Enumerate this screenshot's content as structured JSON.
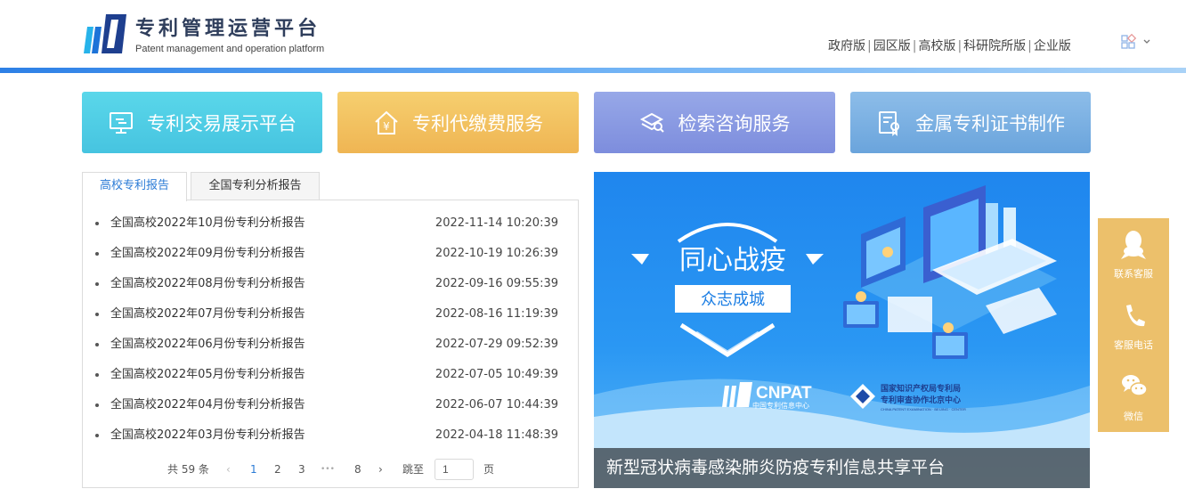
{
  "header": {
    "title": "专利管理运营平台",
    "subtitle": "Patent management and operation platform",
    "versions": [
      "政府版",
      "园区版",
      "高校版",
      "科研院所版",
      "企业版"
    ],
    "separator": "|"
  },
  "services": [
    {
      "label": "专利交易展示平台",
      "icon": "monitor-icon"
    },
    {
      "label": "专利代缴费服务",
      "icon": "house-yen-icon"
    },
    {
      "label": "检索咨询服务",
      "icon": "search-layers-icon"
    },
    {
      "label": "金属专利证书制作",
      "icon": "certificate-icon"
    }
  ],
  "reports": {
    "tabs": [
      "高校专利报告",
      "全国专利分析报告"
    ],
    "items": [
      {
        "title": "全国高校2022年10月份专利分析报告",
        "date": "2022-11-14 10:20:39"
      },
      {
        "title": "全国高校2022年09月份专利分析报告",
        "date": "2022-10-19 10:26:39"
      },
      {
        "title": "全国高校2022年08月份专利分析报告",
        "date": "2022-09-16 09:55:39"
      },
      {
        "title": "全国高校2022年07月份专利分析报告",
        "date": "2022-08-16 11:19:39"
      },
      {
        "title": "全国高校2022年06月份专利分析报告",
        "date": "2022-07-29 09:52:39"
      },
      {
        "title": "全国高校2022年05月份专利分析报告",
        "date": "2022-07-05 10:49:39"
      },
      {
        "title": "全国高校2022年04月份专利分析报告",
        "date": "2022-06-07 10:44:39"
      },
      {
        "title": "全国高校2022年03月份专利分析报告",
        "date": "2022-04-18 11:48:39"
      }
    ],
    "pagination": {
      "total_text": "共 59 条",
      "prev": "‹",
      "pages": [
        "1",
        "2",
        "3"
      ],
      "ellipsis": "•••",
      "last_page": "8",
      "next": "›",
      "jump_label": "跳至",
      "jump_value": "1",
      "page_unit": "页"
    }
  },
  "banner": {
    "headline": "同心战疫",
    "subheadline": "众志成城",
    "cnpat": "CNPAT",
    "cnpat_sub": "中国专利信息中心",
    "org_line1": "国家知识产权局专利局",
    "org_line2": "专利审查协作北京中心",
    "org_en": "CHINA PATENT EXAMINATION · BEIJING · CENTER",
    "caption": "新型冠状病毒感染肺炎防疫专利信息共享平台"
  },
  "side": [
    {
      "label": "联系客服",
      "icon": "qq-icon"
    },
    {
      "label": "客服电话",
      "icon": "phone-icon"
    },
    {
      "label": "微信",
      "icon": "wechat-icon"
    }
  ],
  "colors": {
    "accent": "#2b7bd6",
    "service1": "#50cfe6",
    "service2": "#f2c260",
    "service3": "#8a9ae3",
    "service4": "#7bb0e2",
    "side_float": "#ecc06b",
    "banner": "#2a97f3"
  }
}
